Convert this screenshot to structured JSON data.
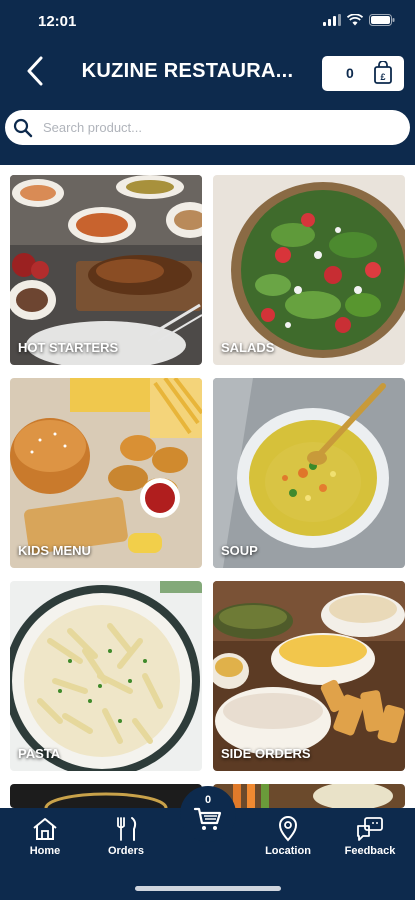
{
  "status_bar": {
    "time": "12:01"
  },
  "header": {
    "title": "KUZINE RESTAURA...",
    "cart_count": "0"
  },
  "search": {
    "placeholder": "Search product..."
  },
  "categories": [
    {
      "label": "HOT STARTERS"
    },
    {
      "label": "SALADS"
    },
    {
      "label": "KIDS MENU"
    },
    {
      "label": "SOUP"
    },
    {
      "label": "PASTA"
    },
    {
      "label": "SIDE ORDERS"
    }
  ],
  "bottom_nav": {
    "cart_count": "0",
    "items": [
      {
        "label": "Home",
        "icon": "home-icon"
      },
      {
        "label": "Orders",
        "icon": "utensils-icon"
      },
      {
        "label": "Location",
        "icon": "location-pin-icon"
      },
      {
        "label": "Feedback",
        "icon": "feedback-icon"
      }
    ]
  },
  "colors": {
    "primary": "#0d2a4d",
    "white": "#ffffff"
  }
}
